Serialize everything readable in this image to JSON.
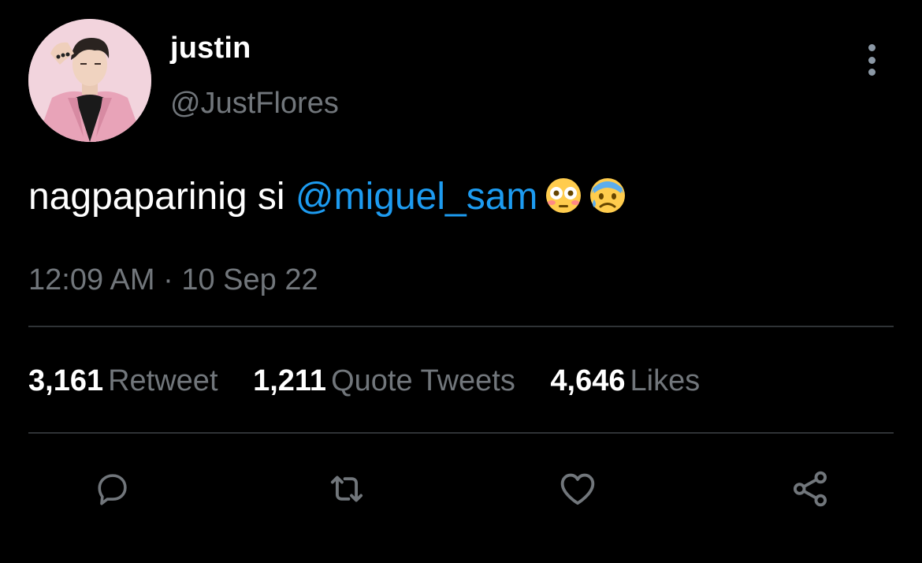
{
  "user": {
    "display_name": "justin",
    "handle": "@JustFlores",
    "avatar": "profile-photo-pink-suit"
  },
  "tweet": {
    "text_prefix": "nagpaparinig si ",
    "mention": "@miguel_sam",
    "emojis": [
      "flushed-face",
      "anxious-face-with-sweat"
    ],
    "timestamp": "12:09 AM · 10 Sep 22"
  },
  "stats": {
    "retweets": {
      "count": "3,161",
      "label": "Retweet"
    },
    "quotes": {
      "count": "1,211",
      "label": "Quote Tweets"
    },
    "likes": {
      "count": "4,646",
      "label": "Likes"
    }
  },
  "actions": [
    "reply-icon",
    "retweet-icon",
    "like-icon",
    "share-icon"
  ],
  "colors": {
    "background": "#000000",
    "text_primary": "#ffffff",
    "text_secondary": "#71767b",
    "link": "#1d9bf0",
    "divider": "#2f3336"
  }
}
